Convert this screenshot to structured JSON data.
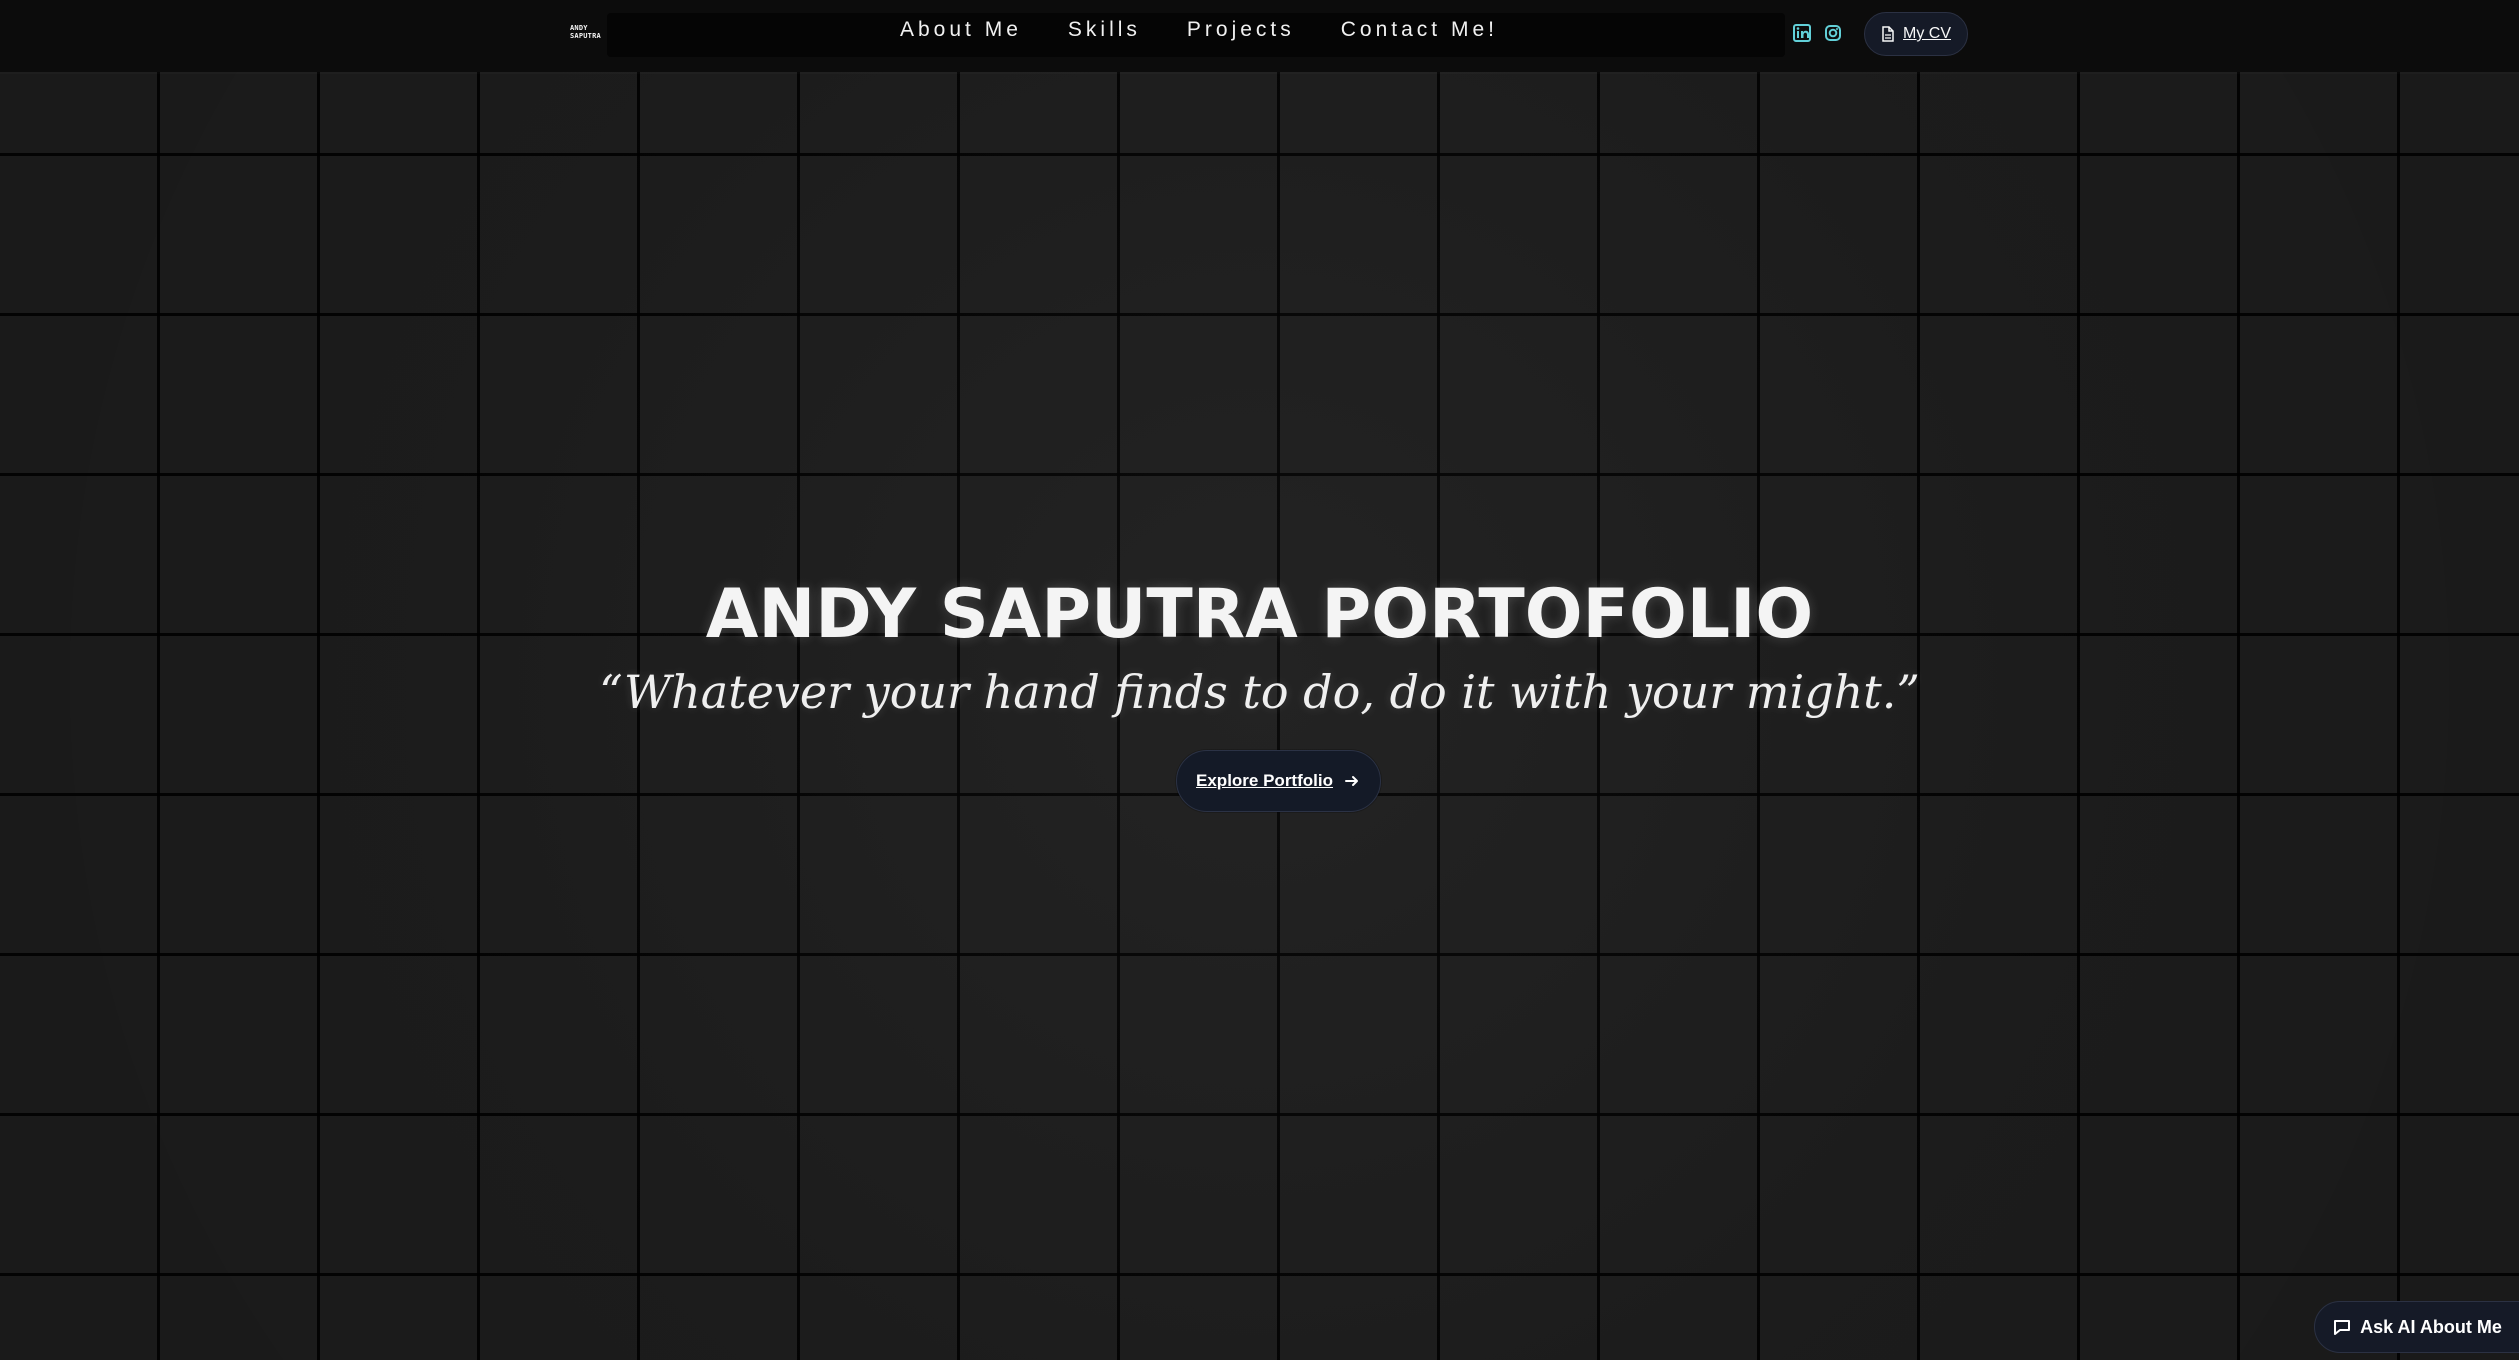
{
  "header": {
    "logo_line1": "ANDY",
    "logo_line2": "SAPUTRA",
    "nav": [
      "About Me",
      "Skills",
      "Projects",
      "Contact Me!"
    ],
    "cv_label": "My CV",
    "social_icons": [
      "linkedin-icon",
      "instagram-icon"
    ],
    "accent": "#62d0d8"
  },
  "hero": {
    "title": "ANDY SAPUTRA PORTOFOLIO",
    "quote": "“Whatever your hand finds to do, do it with your might.”",
    "button_label": "Explore Portfolio",
    "button_icon": "arrow-right-icon"
  },
  "floating": {
    "ai_label": "Ask AI About Me",
    "ai_icon": "chat-icon"
  }
}
